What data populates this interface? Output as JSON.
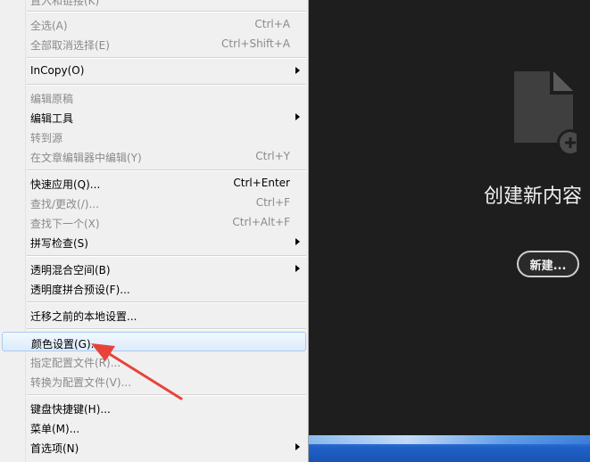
{
  "menu": {
    "top_partial": "置入和链接(K)",
    "items": [
      {
        "label": "全选(A)",
        "shortcut": "Ctrl+A",
        "disabled": true,
        "submenu": false
      },
      {
        "label": "全部取消选择(E)",
        "shortcut": "Ctrl+Shift+A",
        "disabled": true,
        "submenu": false
      },
      {
        "label": "InCopy(O)",
        "shortcut": "",
        "disabled": false,
        "submenu": true
      },
      {
        "label": "编辑原稿",
        "shortcut": "",
        "disabled": true,
        "submenu": false
      },
      {
        "label": "编辑工具",
        "shortcut": "",
        "disabled": false,
        "submenu": true
      },
      {
        "label": "转到源",
        "shortcut": "",
        "disabled": true,
        "submenu": false
      },
      {
        "label": "在文章编辑器中编辑(Y)",
        "shortcut": "Ctrl+Y",
        "disabled": true,
        "submenu": false
      },
      {
        "label": "快速应用(Q)...",
        "shortcut": "Ctrl+Enter",
        "disabled": false,
        "submenu": false
      },
      {
        "label": "查找/更改(/)...",
        "shortcut": "Ctrl+F",
        "disabled": true,
        "submenu": false
      },
      {
        "label": "查找下一个(X)",
        "shortcut": "Ctrl+Alt+F",
        "disabled": true,
        "submenu": false
      },
      {
        "label": "拼写检查(S)",
        "shortcut": "",
        "disabled": false,
        "submenu": true
      },
      {
        "label": "透明混合空间(B)",
        "shortcut": "",
        "disabled": false,
        "submenu": true
      },
      {
        "label": "透明度拼合预设(F)...",
        "shortcut": "",
        "disabled": false,
        "submenu": false
      },
      {
        "label": "迁移之前的本地设置...",
        "shortcut": "",
        "disabled": false,
        "submenu": false
      },
      {
        "label": "颜色设置(G)...",
        "shortcut": "",
        "disabled": false,
        "submenu": false,
        "highlighted": true
      },
      {
        "label": "指定配置文件(R)...",
        "shortcut": "",
        "disabled": true,
        "submenu": false
      },
      {
        "label": "转换为配置文件(V)...",
        "shortcut": "",
        "disabled": true,
        "submenu": false
      },
      {
        "label": "键盘快捷键(H)...",
        "shortcut": "",
        "disabled": false,
        "submenu": false
      },
      {
        "label": "菜单(M)...",
        "shortcut": "",
        "disabled": false,
        "submenu": false
      },
      {
        "label": "首选项(N)",
        "shortcut": "",
        "disabled": false,
        "submenu": true
      }
    ]
  },
  "workspace": {
    "heading": "创建新内容",
    "new_button": "新建..."
  },
  "colors": {
    "workspace_bg": "#1e1e1e",
    "menu_bg": "#f0f0f0",
    "highlight_border": "#a9cbf1",
    "annotation_arrow": "#e8433a"
  },
  "icons": {
    "new_document": "document-add-icon",
    "submenu": "chevron-right-icon"
  }
}
